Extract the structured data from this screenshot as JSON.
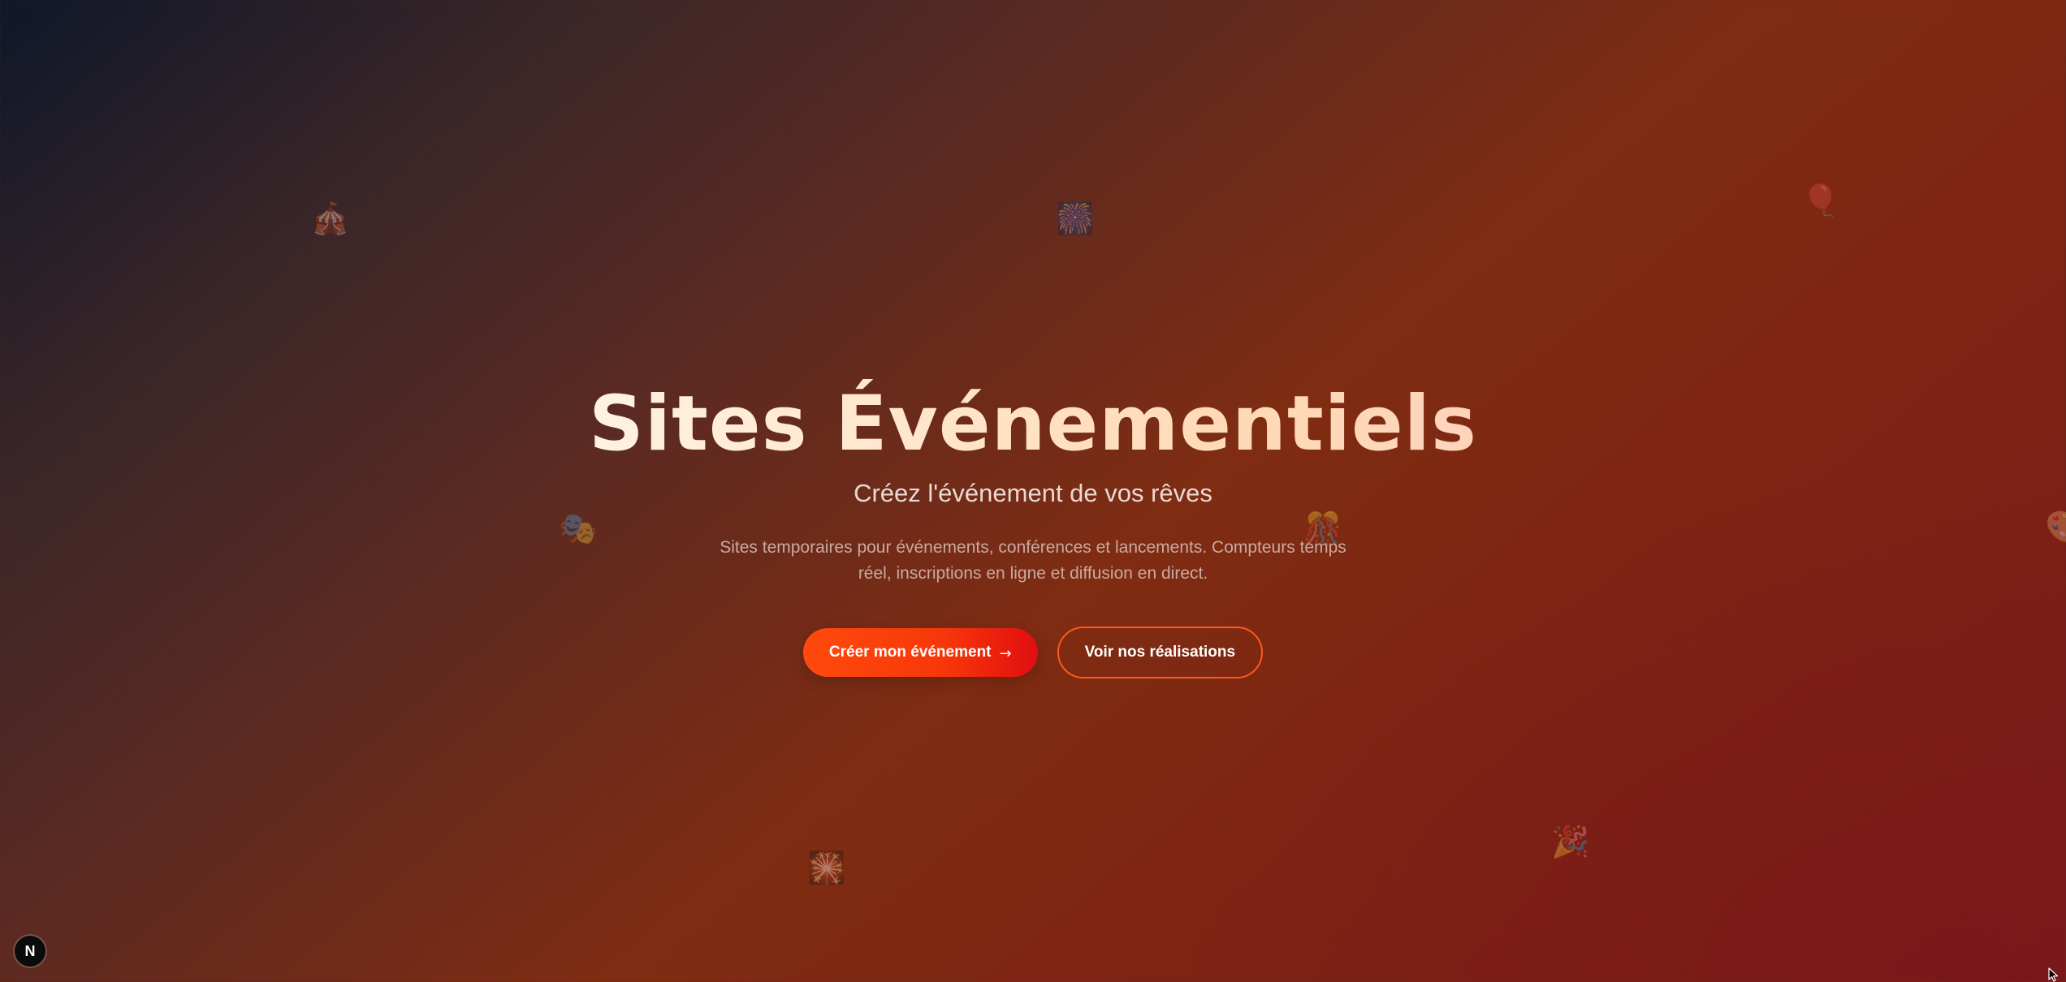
{
  "hero": {
    "title": "Sites Événementiels",
    "subtitle": "Créez l'événement de vos rêves",
    "description": "Sites temporaires pour événements, conférences et lancements. Compteurs temps réel, inscriptions en ligne et diffusion en direct."
  },
  "cta": {
    "primary_label": "Créer mon événement",
    "primary_arrow": "→",
    "secondary_label": "Voir nos réalisations"
  },
  "decorations": [
    {
      "icon": "circus-tent-icon",
      "glyph": "🎪"
    },
    {
      "icon": "firework-icon",
      "glyph": "🎆"
    },
    {
      "icon": "balloon-icon",
      "glyph": "🎈"
    },
    {
      "icon": "theater-masks-icon",
      "glyph": "🎭"
    },
    {
      "icon": "ribbon-icon",
      "glyph": "🎊"
    },
    {
      "icon": "palette-icon",
      "glyph": "🎨"
    },
    {
      "icon": "sparkler-icon",
      "glyph": "🎇"
    },
    {
      "icon": "party-popper-icon",
      "glyph": "🎉"
    }
  ],
  "dev_badge": {
    "icon": "nextjs-logo-icon",
    "label": "N"
  },
  "colors": {
    "accent": "#ff4a0c",
    "accent_end": "#e10e10",
    "background_start": "#0f1729",
    "background_end": "#7a1c1c"
  }
}
